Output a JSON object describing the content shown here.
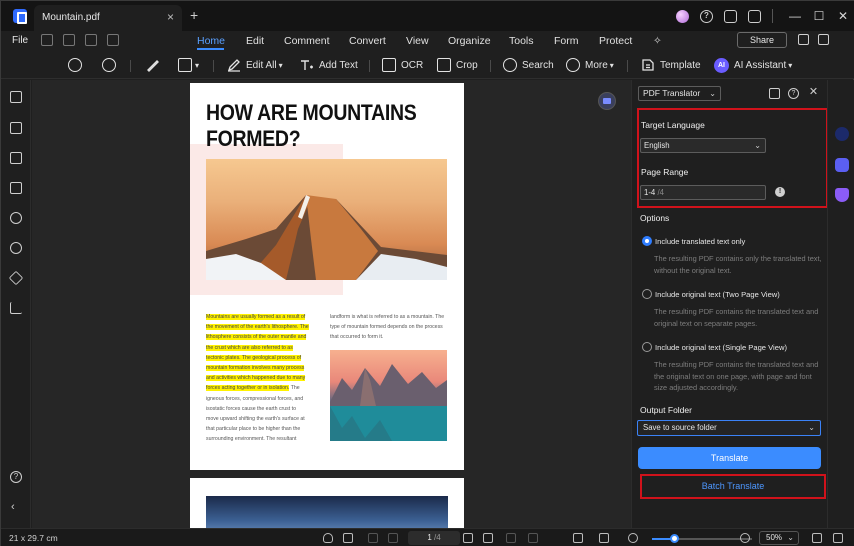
{
  "window": {
    "tab_title": "Mountain.pdf",
    "tab_close": "×",
    "tab_add": "+",
    "minimize": "—",
    "maximize": "☐",
    "close": "✕"
  },
  "menu": {
    "file": "File",
    "items": [
      "Home",
      "Edit",
      "Comment",
      "Convert",
      "View",
      "Organize",
      "Tools",
      "Form",
      "Protect"
    ],
    "active": "Home",
    "share": "Share"
  },
  "toolbar": {
    "edit_all": "Edit All",
    "add_text": "Add Text",
    "ocr": "OCR",
    "crop": "Crop",
    "search": "Search",
    "more": "More",
    "template": "Template",
    "ai_assistant": "AI Assistant",
    "ai_badge": "AI"
  },
  "document": {
    "title": "HOW ARE MOUNTAINS FORMED?",
    "col1_highlighted": "Mountains are usually formed as a result of the movement of the earth's lithosphere. The lithosphere consists of the outer mantle and the crust which are also referred to as tectonic plates. The geological process of mountain formation involves many process and activities which happened due to many forces acting together or in isolation.",
    "col1_rest": "The igneous forces, compressional forces, and isostatic forces cause the earth crust to move upward shifting the earth's surface at that particular place to be higher than the surrounding environment. The resultant",
    "col2": "landform is what is referred to as a mountain. The type of mountain formed depends on the process that occurred to form it."
  },
  "panel": {
    "tool_select": "PDF Translator",
    "target_language_label": "Target Language",
    "target_language_value": "English",
    "page_range_label": "Page Range",
    "page_range_value": "1-4",
    "page_range_total": "/4",
    "options_label": "Options",
    "option1_label": "Include translated text only",
    "option1_desc": "The resulting PDF contains only the translated text, without the original text.",
    "option2_label": "Include original text (Two Page View)",
    "option2_desc": "The resulting PDF contains the translated text and original text on separate pages.",
    "option3_label": "Include original text (Single Page View)",
    "option3_desc": "The resulting PDF contains the translated text and the original text on one page, with page and font size adjusted accordingly.",
    "selected_option": 1,
    "output_folder_label": "Output Folder",
    "output_folder_value": "Save to source folder",
    "translate_button": "Translate",
    "batch_translate_button": "Batch Translate"
  },
  "status": {
    "page_size": "21 x 29.7 cm",
    "current_page": "1",
    "total_pages": "/4",
    "zoom": "50%",
    "zoom_fraction": 0.22
  },
  "colors": {
    "accent": "#3b8cff",
    "highlight_box": "#d0121b",
    "text_highlight": "#fff200"
  },
  "icons": {
    "sidebar": [
      "page-icon",
      "bookmark-icon",
      "comment-icon",
      "thumbnails-icon",
      "attachment-icon",
      "search-icon",
      "layers-icon",
      "signature-icon",
      "help-icon",
      "collapse-icon"
    ],
    "right_rail": [
      "ai-chat-icon",
      "translate-icon",
      "protect-icon"
    ]
  }
}
